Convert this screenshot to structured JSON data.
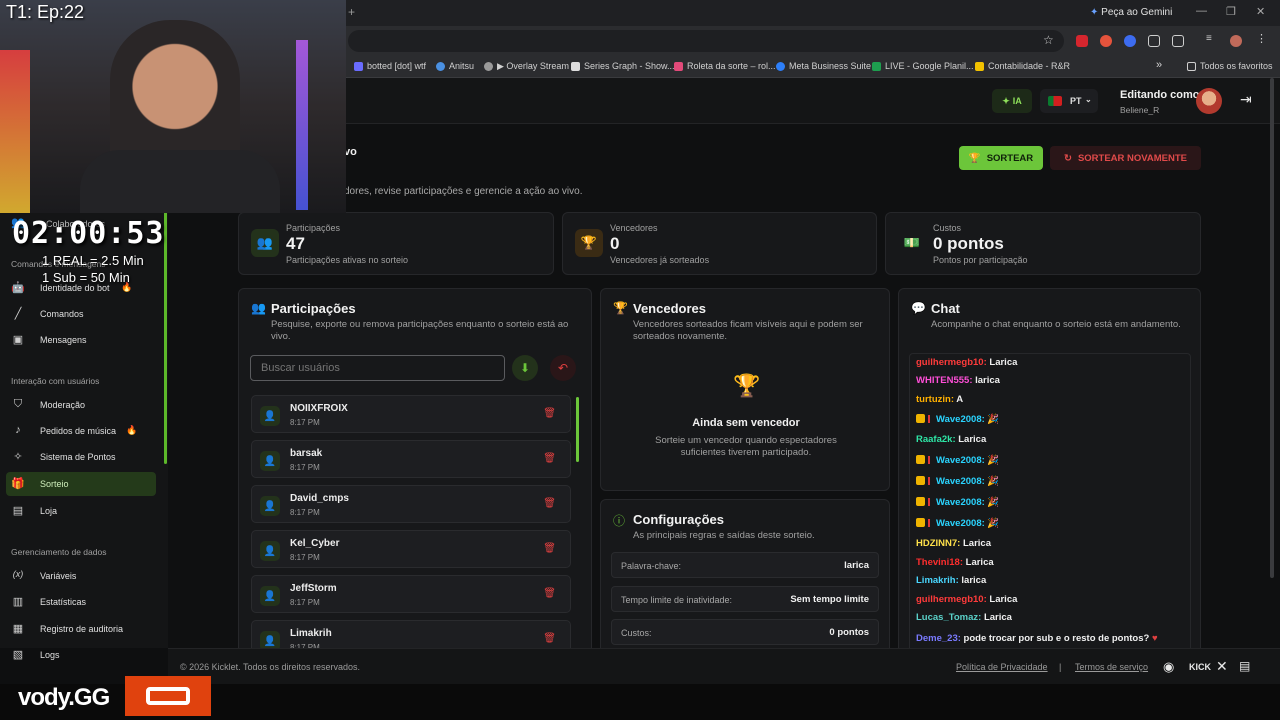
{
  "browser": {
    "gemini_label": "Peça ao Gemini",
    "bookmarks": [
      {
        "label": "botted [dot] wtf",
        "color": "#6a6cff"
      },
      {
        "label": "Anitsu",
        "color": "#4a90e2"
      },
      {
        "label": "▶ Overlay Stream",
        "color": "#9a9a9a"
      },
      {
        "label": "Series Graph - Show...",
        "color": "#dddddd"
      },
      {
        "label": "Roleta da sorte – rol...",
        "color": "#e24a7a"
      },
      {
        "label": "Meta Business Suite",
        "color": "#2d7ff9"
      },
      {
        "label": "LIVE - Google Planil...",
        "color": "#1e9e4f"
      },
      {
        "label": "Contabilidade - R&R",
        "color": "#f2c200"
      }
    ],
    "all_bookmarks_label": "Todos os favoritos"
  },
  "header": {
    "ia_label": "IA",
    "lang_label": "PT",
    "editing_label": "Editando como",
    "user_name": "Beliene_R"
  },
  "overlay": {
    "episode": "T1: Ep:22",
    "timer": "02:00:53",
    "rule1": "1 REAL = 2.5 Min",
    "rule2": "1 Sub = 50 Min",
    "vody_label": "vody.GG"
  },
  "sidebar": {
    "top_item": "Colaboradores",
    "section_commands": "Comandos e mensagens",
    "items_commands": [
      {
        "label": "Identidade do bot",
        "icon": "bot-icon",
        "fire": true
      },
      {
        "label": "Comandos",
        "icon": "wand-icon",
        "fire": false
      },
      {
        "label": "Mensagens",
        "icon": "messages-icon",
        "fire": false
      }
    ],
    "section_interaction": "Interação com usuários",
    "items_interaction": [
      {
        "label": "Moderação",
        "icon": "shield-icon",
        "fire": false
      },
      {
        "label": "Pedidos de música",
        "icon": "music-icon",
        "fire": true
      },
      {
        "label": "Sistema de Pontos",
        "icon": "sparkle-icon",
        "fire": false
      },
      {
        "label": "Sorteio",
        "icon": "gift-icon",
        "fire": false,
        "active": true
      },
      {
        "label": "Loja",
        "icon": "store-icon",
        "fire": false
      }
    ],
    "section_data": "Gerenciamento de dados",
    "items_data": [
      {
        "label": "Variáveis",
        "icon": "variable-icon"
      },
      {
        "label": "Estatísticas",
        "icon": "stats-icon"
      },
      {
        "label": "Registro de auditoria",
        "icon": "audit-icon"
      },
      {
        "label": "Logs",
        "icon": "logs-icon"
      }
    ]
  },
  "page": {
    "title_partial": "vo",
    "subtitle_partial": "dores, revise participações e gerencie a ação ao vivo.",
    "sortear_label": "SORTEAR",
    "resortear_label": "SORTEAR NOVAMENTE"
  },
  "stats": [
    {
      "label": "Participações",
      "value": "47",
      "desc": "Participações ativas no sorteio",
      "icon": "users-icon"
    },
    {
      "label": "Vencedores",
      "value": "0",
      "desc": "Vencedores já sorteados",
      "icon": "trophy-icon"
    },
    {
      "label": "Custos",
      "value": "0 pontos",
      "desc": "Pontos por participação",
      "icon": "money-icon"
    }
  ],
  "participations": {
    "title": "Participações",
    "desc": "Pesquise, exporte ou remova participações enquanto o sorteio está ao vivo.",
    "search_placeholder": "Buscar usuários",
    "entries": [
      {
        "name": "NOIIXFROIX",
        "time": "8:17 PM"
      },
      {
        "name": "barsak",
        "time": "8:17 PM"
      },
      {
        "name": "David_cmps",
        "time": "8:17 PM"
      },
      {
        "name": "Kel_Cyber",
        "time": "8:17 PM"
      },
      {
        "name": "JeffStorm",
        "time": "8:17 PM"
      },
      {
        "name": "Limakrih",
        "time": "8:17 PM"
      }
    ]
  },
  "winners": {
    "title": "Vencedores",
    "desc": "Vencedores sorteados ficam visíveis aqui e podem ser sorteados novamente.",
    "empty_title": "Ainda sem vencedor",
    "empty_desc": "Sorteie um vencedor quando espectadores suficientes tiverem participado."
  },
  "config": {
    "title": "Configurações",
    "desc": "As principais regras e saídas deste sorteio.",
    "rows": [
      {
        "key": "Palavra-chave:",
        "value": "larica"
      },
      {
        "key": "Tempo limite de inatividade:",
        "value": "Sem tempo limite"
      },
      {
        "key": "Custos:",
        "value": "0 pontos"
      }
    ]
  },
  "chat": {
    "title": "Chat",
    "desc": "Acompanhe o chat enquanto o sorteio está em andamento.",
    "messages": [
      {
        "user": "guilhermegb10:",
        "color": "#ff3b3b",
        "text": "Larica",
        "badge": false
      },
      {
        "user": "WHITEN555:",
        "color": "#ff4fd8",
        "text": "larica",
        "badge": false
      },
      {
        "user": "turtuzin:",
        "color": "#ffb000",
        "text": "A",
        "badge": false
      },
      {
        "user": "Wave2008:",
        "color": "#2ad4ff",
        "text": "🎉",
        "badge": true
      },
      {
        "user": "Raafa2k:",
        "color": "#2ee6a6",
        "text": "Larica",
        "badge": false
      },
      {
        "user": "Wave2008:",
        "color": "#2ad4ff",
        "text": "🎉",
        "badge": true
      },
      {
        "user": "Wave2008:",
        "color": "#2ad4ff",
        "text": "🎉",
        "badge": true
      },
      {
        "user": "Wave2008:",
        "color": "#2ad4ff",
        "text": "🎉",
        "badge": true
      },
      {
        "user": "Wave2008:",
        "color": "#2ad4ff",
        "text": "🎉",
        "badge": true
      },
      {
        "user": "HDZINN7:",
        "color": "#ffe14a",
        "text": "Larica",
        "badge": false
      },
      {
        "user": "Thevini18:",
        "color": "#ff2e2e",
        "text": "Larica",
        "badge": false
      },
      {
        "user": "Limakrih:",
        "color": "#4ad7ff",
        "text": "larica",
        "badge": false
      },
      {
        "user": "guilhermegb10:",
        "color": "#ff3b3b",
        "text": "Larica",
        "badge": false
      },
      {
        "user": "Lucas_Tomaz:",
        "color": "#5ad0c8",
        "text": "Larica",
        "badge": false
      },
      {
        "user": "Deme_23:",
        "color": "#7a7aff",
        "text": "pode trocar por sub e o resto de pontos?",
        "badge": false
      }
    ]
  },
  "footer": {
    "copyright": "© 2026 Kicklet. Todos os direitos reservados.",
    "privacy": "Política de Privacidade",
    "separator": "|",
    "terms": "Termos de serviço",
    "kick_label": "KICK"
  },
  "colors": {
    "accent": "#6cc63a",
    "danger": "#e04040"
  }
}
